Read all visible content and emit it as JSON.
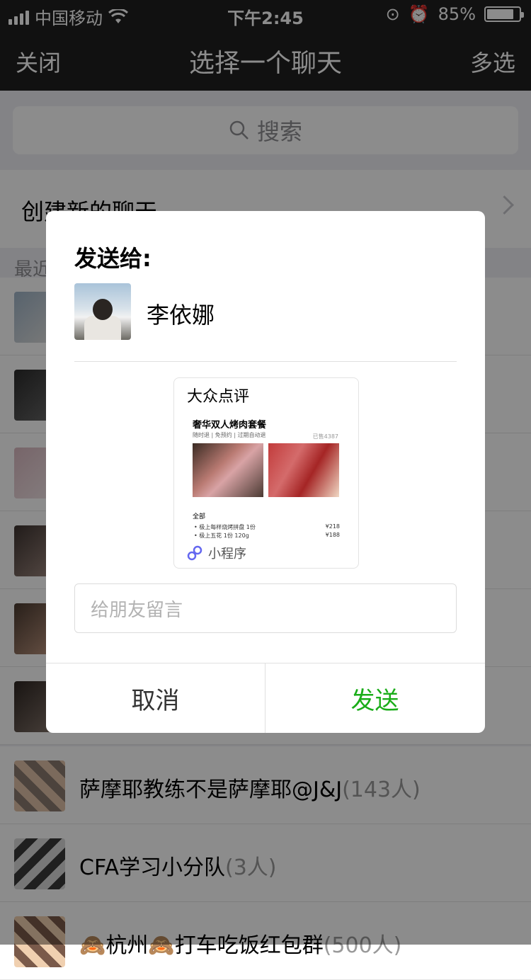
{
  "status": {
    "carrier": "中国移动",
    "time": "下午2:45",
    "battery": "85%",
    "battery_level": 0.85
  },
  "nav": {
    "close": "关闭",
    "title": "选择一个聊天",
    "multi": "多选"
  },
  "search": {
    "placeholder": "搜索"
  },
  "new_chat": {
    "label": "创建新的聊天"
  },
  "recent_label": "最近",
  "groups": [
    {
      "name": "萨摩耶教练不是萨摩耶@J&J",
      "count": "(143人)"
    },
    {
      "name": "CFA学习小分队",
      "count": "(3人)"
    },
    {
      "name": "🙈杭州🙈打车吃饭红包群",
      "count": "(500人)"
    }
  ],
  "dialog": {
    "send_to": "发送给:",
    "recipient": "李依娜",
    "card": {
      "brand": "大众点评",
      "item_title": "奢华双人烤肉套餐",
      "tags": "随时退 | 免预约 | 过期自动退",
      "sold": "已售4387",
      "section": "全部",
      "line1_name": "• 极上每样烧烤拼盘 1份",
      "line1_price": "¥218",
      "line2_name": "• 极上五花 1份 120g",
      "line2_price": "¥188",
      "mini_program": "小程序"
    },
    "message_placeholder": "给朋友留言",
    "cancel": "取消",
    "send": "发送"
  },
  "colors": {
    "nav_bg": "#1f1f1f",
    "send_green": "#1aad19",
    "overlay": "rgba(0,0,0,0.45)"
  }
}
